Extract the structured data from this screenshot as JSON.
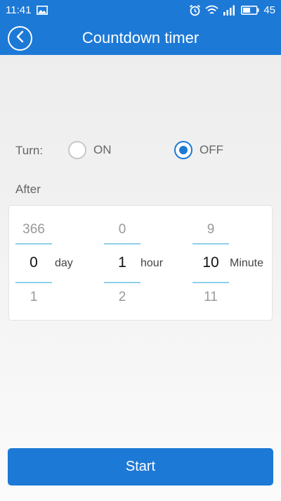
{
  "status_bar": {
    "time": "11:41",
    "battery_level": "45",
    "icons": [
      "image-icon",
      "alarm-icon",
      "wifi-icon",
      "signal-icon",
      "battery-icon"
    ]
  },
  "header": {
    "title": "Countdown timer",
    "back_icon": "back-icon"
  },
  "turn": {
    "label": "Turn:",
    "options": [
      {
        "label": "ON",
        "selected": false
      },
      {
        "label": "OFF",
        "selected": true
      }
    ]
  },
  "after": {
    "label": "After",
    "pickers": [
      {
        "prev": "366",
        "current": "0",
        "next": "1",
        "unit": "day"
      },
      {
        "prev": "0",
        "current": "1",
        "next": "2",
        "unit": "hour"
      },
      {
        "prev": "9",
        "current": "10",
        "next": "11",
        "unit": "Minute"
      }
    ]
  },
  "start_button": {
    "label": "Start"
  },
  "colors": {
    "primary": "#1d79d6",
    "picker_line": "#8fd0ea",
    "background": "#f1f1f1"
  }
}
